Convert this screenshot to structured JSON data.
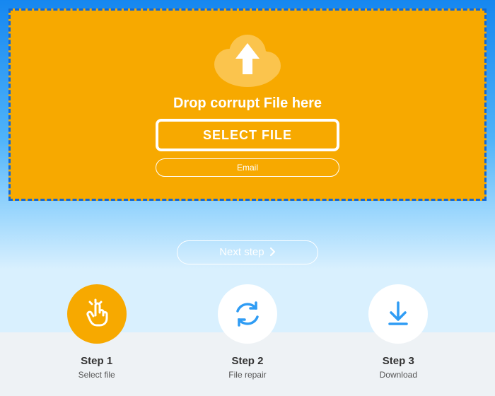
{
  "dropzone": {
    "label": "Drop corrupt File here",
    "select_button": "SELECT FILE",
    "email_placeholder": "Email"
  },
  "next_button": "Next step",
  "steps": [
    {
      "title": "Step 1",
      "subtitle": "Select file"
    },
    {
      "title": "Step 2",
      "subtitle": "File repair"
    },
    {
      "title": "Step 3",
      "subtitle": "Download"
    }
  ]
}
